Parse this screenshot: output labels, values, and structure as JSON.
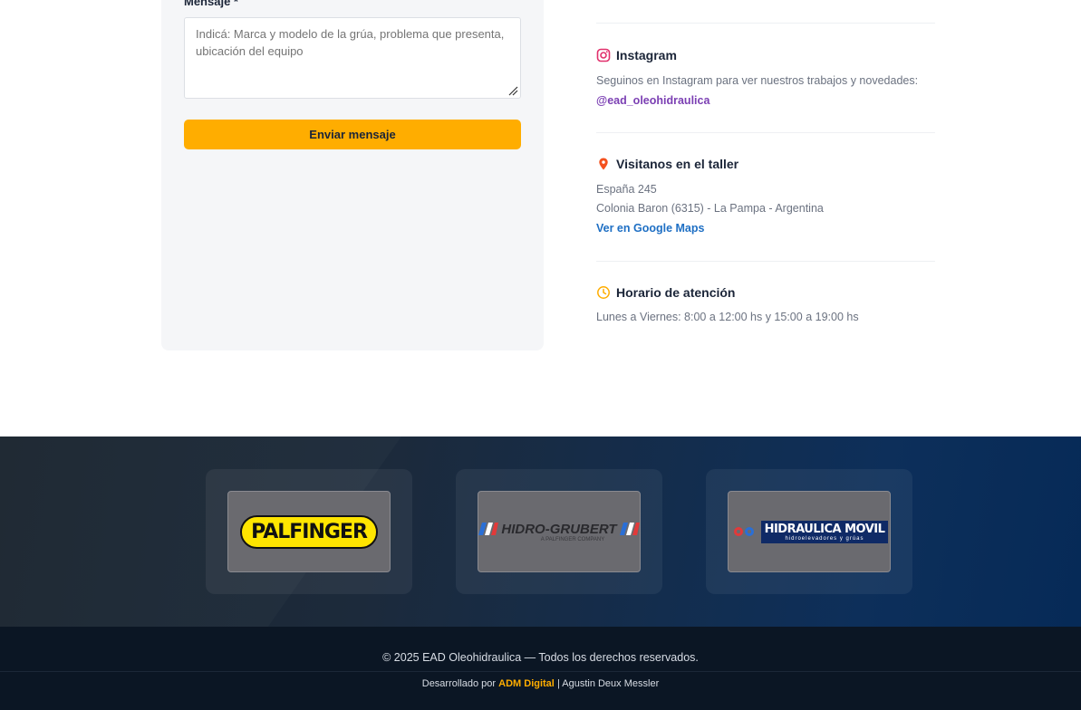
{
  "form": {
    "message_label": "Mensaje *",
    "message_placeholder": "Indicá: Marca y modelo de la grúa, problema que presenta, ubicación del equipo",
    "submit_label": "Enviar mensaje"
  },
  "contact": {
    "instagram": {
      "title": "Instagram",
      "description": "Seguinos en Instagram para ver nuestros trabajos y novedades:",
      "handle": "@ead_oleohidraulica",
      "icon": "instagram-icon",
      "color": "#e1306c"
    },
    "location": {
      "title": "Visitanos en el taller",
      "address_line1": "España 245",
      "address_line2": "Colonia Baron (6315) - La Pampa - Argentina",
      "maps_link": "Ver en Google Maps",
      "icon": "map-pin-icon",
      "color": "#f4511e"
    },
    "hours": {
      "title": "Horario de atención",
      "schedule": "Lunes a Viernes: 8:00 a 12:00 hs y 15:00 a 19:00 hs",
      "icon": "clock-icon",
      "color": "#ffad00"
    }
  },
  "brands": [
    {
      "name": "PALFINGER"
    },
    {
      "name": "HIDRO-GRUBERT",
      "tagline": "A PALFINGER COMPANY"
    },
    {
      "name": "HIDRAULICA MOVIL",
      "tagline": "hidroelevadores y grúas"
    }
  ],
  "footer": {
    "copyright": "© 2025 EAD Oleohidraulica — Todos los derechos reservados.",
    "dev_prefix": "Desarrollado por",
    "dev_company": "ADM Digital",
    "dev_suffix": "| Agustin Deux Messler"
  },
  "colors": {
    "accent": "#ffad00",
    "link_purple": "#7b3fb3",
    "link_blue": "#1e6fc4",
    "footer_bg": "#0b1624"
  }
}
